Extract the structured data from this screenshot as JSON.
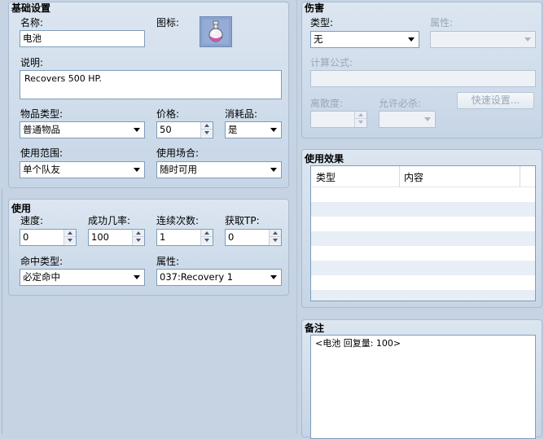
{
  "basic": {
    "title": "基础设置",
    "name_label": "名称:",
    "name_value": "电池",
    "icon_label": "图标:",
    "desc_label": "说明:",
    "desc_value": "Recovers 500 HP.",
    "item_type_label": "物品类型:",
    "item_type_value": "普通物品",
    "price_label": "价格:",
    "price_value": "50",
    "consumable_label": "消耗品:",
    "consumable_value": "是",
    "scope_label": "使用范围:",
    "scope_value": "单个队友",
    "occasion_label": "使用场合:",
    "occasion_value": "随时可用"
  },
  "usage": {
    "title": "使用",
    "speed_label": "速度:",
    "speed_value": "0",
    "success_label": "成功几率:",
    "success_value": "100",
    "repeats_label": "连续次数:",
    "repeats_value": "1",
    "tp_label": "获取TP:",
    "tp_value": "0",
    "hit_type_label": "命中类型:",
    "hit_type_value": "必定命中",
    "element_label": "属性:",
    "element_value": "037:Recovery 1"
  },
  "damage": {
    "title": "伤害",
    "type_label": "类型:",
    "type_value": "无",
    "element_label": "属性:",
    "element_value": "",
    "formula_label": "计算公式:",
    "formula_value": "",
    "variance_label": "离散度:",
    "variance_value": "",
    "critical_label": "允许必杀:",
    "critical_value": "",
    "quick_button": "快速设置..."
  },
  "effects": {
    "title": "使用效果",
    "col_type": "类型",
    "col_content": "内容"
  },
  "note": {
    "title": "备注",
    "value": "<电池 回复量: 100>"
  },
  "icon": {
    "name": "potion-icon",
    "accent": "#c85aa8"
  }
}
